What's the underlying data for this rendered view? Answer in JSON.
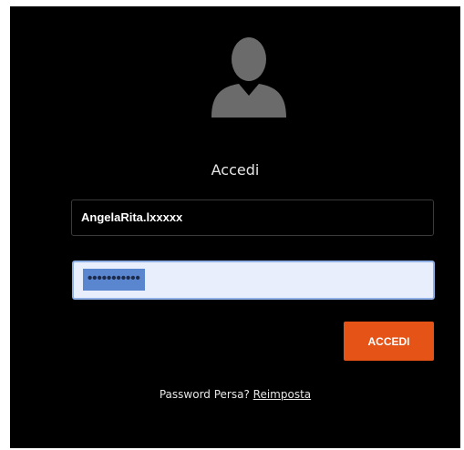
{
  "login": {
    "title": "Accedi",
    "username_value": "AngelaRita.lxxxxx",
    "password_value": "•••••••••••",
    "submit_label": "ACCEDI",
    "forgot_text": "Password Persa?",
    "reset_link": "Reimposta"
  },
  "colors": {
    "background": "#000000",
    "accent": "#e65317",
    "password_field_bg": "#e8eefb",
    "selection": "#5a86cf"
  },
  "icons": {
    "avatar": "user-silhouette-icon"
  }
}
